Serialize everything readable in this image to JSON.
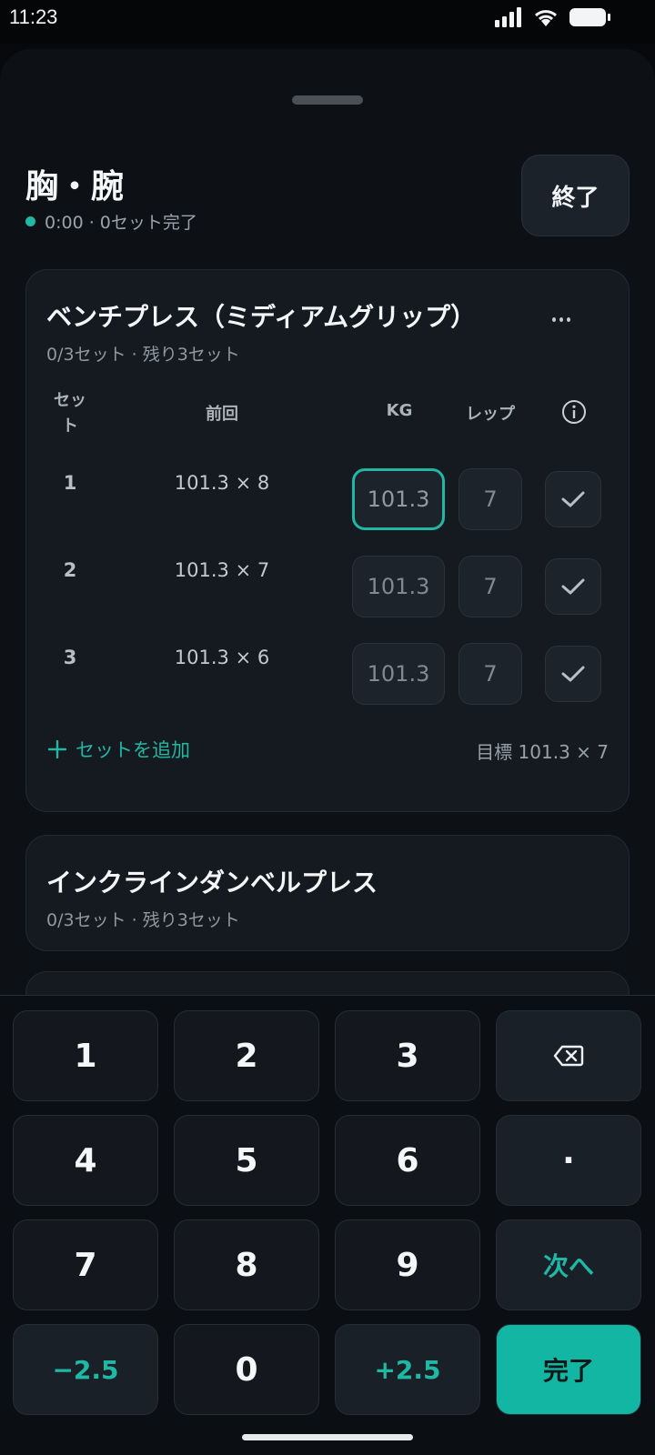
{
  "status": {
    "time": "11:23"
  },
  "workout": {
    "title": "胸・腕",
    "meta": "0:00 · 0セット完了",
    "finish_label": "終了"
  },
  "exercises": [
    {
      "name": "ベンチプレス（ミディアムグリップ）",
      "progress": "0/3セット · 残り3セット",
      "columns": {
        "set": "セット",
        "previous": "前回",
        "kg": "KG",
        "reps": "レップ"
      },
      "sets": [
        {
          "num": "1",
          "previous": "101.3 × 8",
          "kg": "101.3",
          "reps": "7"
        },
        {
          "num": "2",
          "previous": "101.3 × 7",
          "kg": "101.3",
          "reps": "7"
        },
        {
          "num": "3",
          "previous": "101.3 × 6",
          "kg": "101.3",
          "reps": "7"
        }
      ],
      "add_set_label": "セットを追加",
      "target": "目標 101.3 × 7"
    },
    {
      "name": "インクラインダンベルプレス",
      "progress": "0/3セット · 残り3セット"
    }
  ],
  "keypad": {
    "k1": "1",
    "k2": "2",
    "k3": "3",
    "k4": "4",
    "k5": "5",
    "k6": "6",
    "k7": "7",
    "k8": "8",
    "k9": "9",
    "k0": "0",
    "decimal": "·",
    "next": "次へ",
    "minus": "−2.5",
    "plus": "+2.5",
    "done": "完了",
    "backspace_icon": "backspace-icon"
  },
  "colors": {
    "accent": "#1fb8a4",
    "background": "#0d1116",
    "card": "#151a20"
  }
}
